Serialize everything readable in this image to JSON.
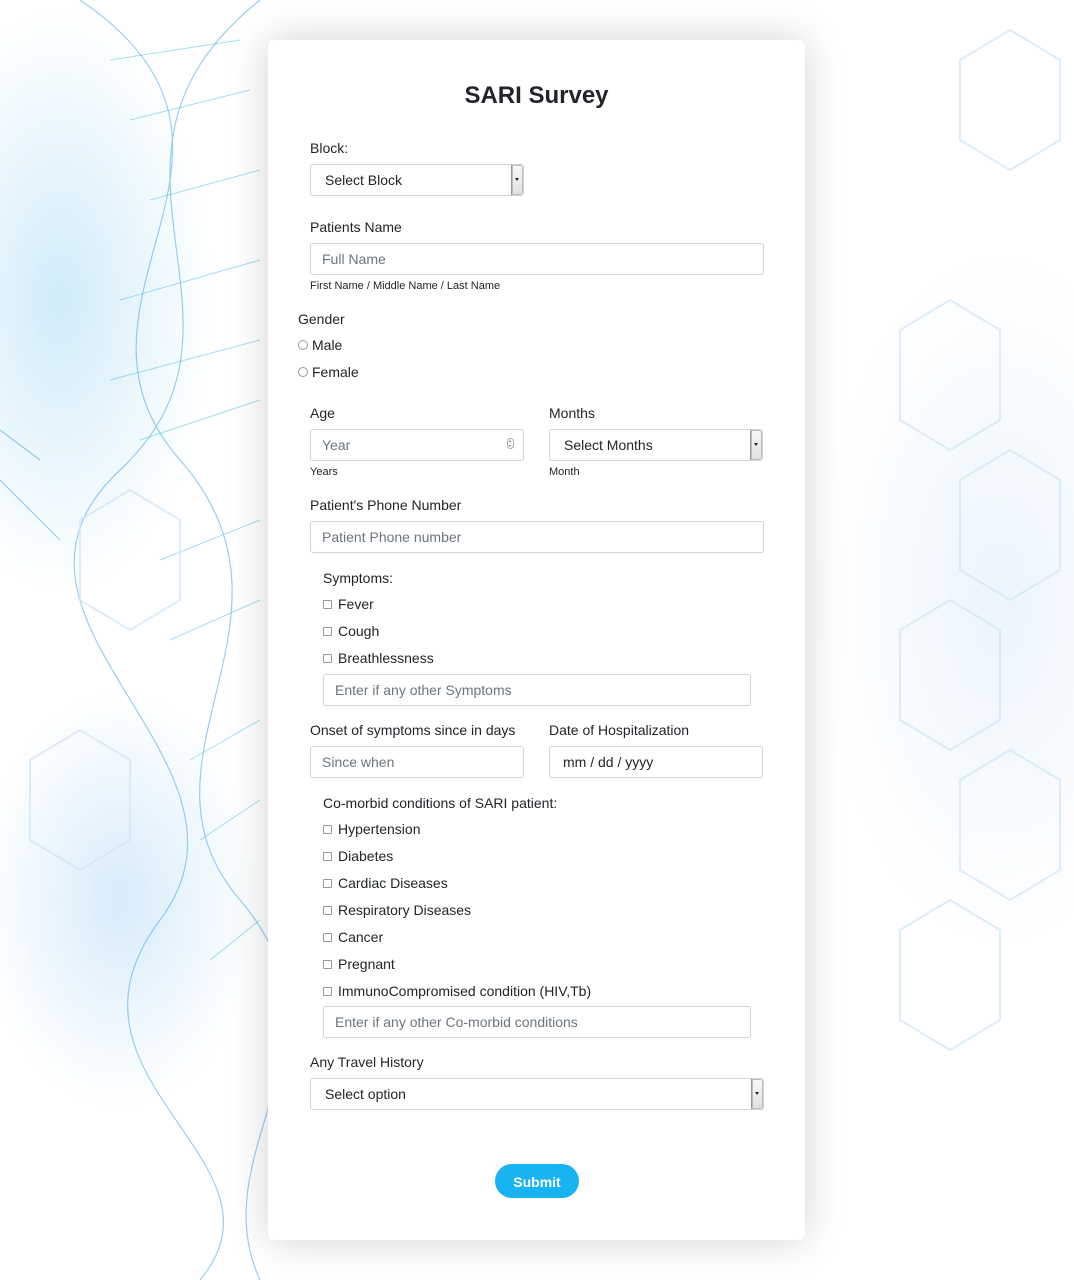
{
  "survey": {
    "title": "SARI Survey",
    "block": {
      "label": "Block:",
      "selected": "Select Block"
    },
    "patient_name": {
      "label": "Patients Name",
      "placeholder": "Full Name",
      "help": "First Name / Middle Name / Last Name"
    },
    "gender": {
      "label": "Gender",
      "options": [
        "Male",
        "Female"
      ]
    },
    "age": {
      "label": "Age",
      "placeholder": "Year",
      "help": "Years"
    },
    "months": {
      "label": "Months",
      "selected": "Select Months",
      "help": "Month"
    },
    "phone": {
      "label": "Patient's Phone Number",
      "placeholder": "Patient Phone number"
    },
    "symptoms": {
      "label": "Symptoms:",
      "options": [
        "Fever",
        "Cough",
        "Breathlessness"
      ],
      "other_placeholder": "Enter if any other Symptoms"
    },
    "onset": {
      "label": "Onset of symptoms since in days",
      "placeholder": "Since when"
    },
    "hospitalization": {
      "label": "Date of Hospitalization",
      "value": "mm / dd / yyyy"
    },
    "comorbid": {
      "label": "Co-morbid conditions of SARI patient:",
      "options": [
        "Hypertension",
        "Diabetes",
        "Cardiac Diseases",
        "Respiratory Diseases",
        "Cancer",
        "Pregnant",
        "ImmunoCompromised condition (HIV,Tb)"
      ],
      "other_placeholder": "Enter if any other Co-morbid conditions"
    },
    "travel": {
      "label": "Any Travel History",
      "selected": "Select option"
    },
    "submit_label": "Submit"
  },
  "colors": {
    "accent": "#17b3f3",
    "background": "#ffffff"
  }
}
